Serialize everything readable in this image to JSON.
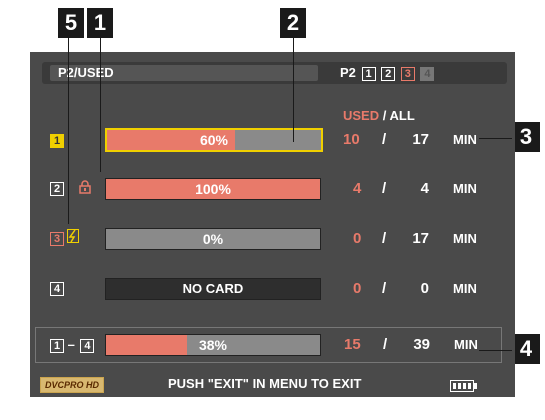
{
  "callouts": {
    "c5": "5",
    "c1": "1",
    "c2": "2",
    "c3": "3",
    "c4": "4"
  },
  "header": {
    "title": "P2/USED",
    "p2_label": "P2",
    "slots": [
      "1",
      "2",
      "3",
      "4"
    ]
  },
  "columns": {
    "used": "USED",
    "slash": "/",
    "all": "ALL"
  },
  "rows": [
    {
      "slot": "1",
      "bar_text": "60%",
      "fill_fraction": 0.6,
      "used": "10",
      "all": "17",
      "unit": "MIN"
    },
    {
      "slot": "2",
      "bar_text": "100%",
      "fill_fraction": 1.0,
      "used": "4",
      "all": "4",
      "unit": "MIN"
    },
    {
      "slot": "3",
      "bar_text": "0%",
      "fill_fraction": 0.0,
      "used": "0",
      "all": "17",
      "unit": "MIN"
    },
    {
      "slot": "4",
      "bar_text": "NO CARD",
      "fill_fraction": 0.0,
      "used": "0",
      "all": "0",
      "unit": "MIN"
    }
  ],
  "total": {
    "label_start": "1",
    "dash": "–",
    "label_end": "4",
    "bar_text": "38%",
    "fill_fraction": 0.38,
    "used": "15",
    "all": "39",
    "unit": "MIN"
  },
  "footer": {
    "logo": "DVCPRO HD",
    "message": "PUSH \"EXIT\" IN MENU TO EXIT"
  },
  "colors": {
    "screen": "#4a4a4a",
    "used": "#e87a6a",
    "selected": "#f0d000",
    "bar": "#8a8a8a"
  }
}
